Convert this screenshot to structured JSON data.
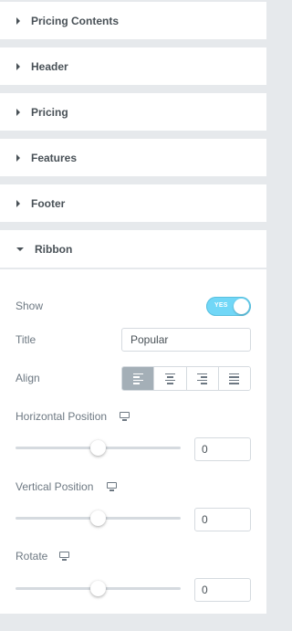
{
  "sections": [
    {
      "label": "Pricing Contents"
    },
    {
      "label": "Header"
    },
    {
      "label": "Pricing"
    },
    {
      "label": "Features"
    },
    {
      "label": "Footer"
    },
    {
      "label": "Ribbon"
    }
  ],
  "ribbon": {
    "show_label": "Show",
    "show_toggle_text": "YES",
    "show_value": true,
    "title_label": "Title",
    "title_value": "Popular",
    "align_label": "Align",
    "align_options": [
      "left",
      "center",
      "right",
      "justify"
    ],
    "align_selected": "left",
    "horizontal_label": "Horizontal Position",
    "horizontal_value": "0",
    "vertical_label": "Vertical Position",
    "vertical_value": "0",
    "rotate_label": "Rotate",
    "rotate_value": "0",
    "responsive_icon": "desktop-icon"
  },
  "colors": {
    "toggle_on": "#71d7f7",
    "panel_bg": "#ffffff",
    "page_bg": "#e6e9ec",
    "active_align": "#a4afb7"
  }
}
